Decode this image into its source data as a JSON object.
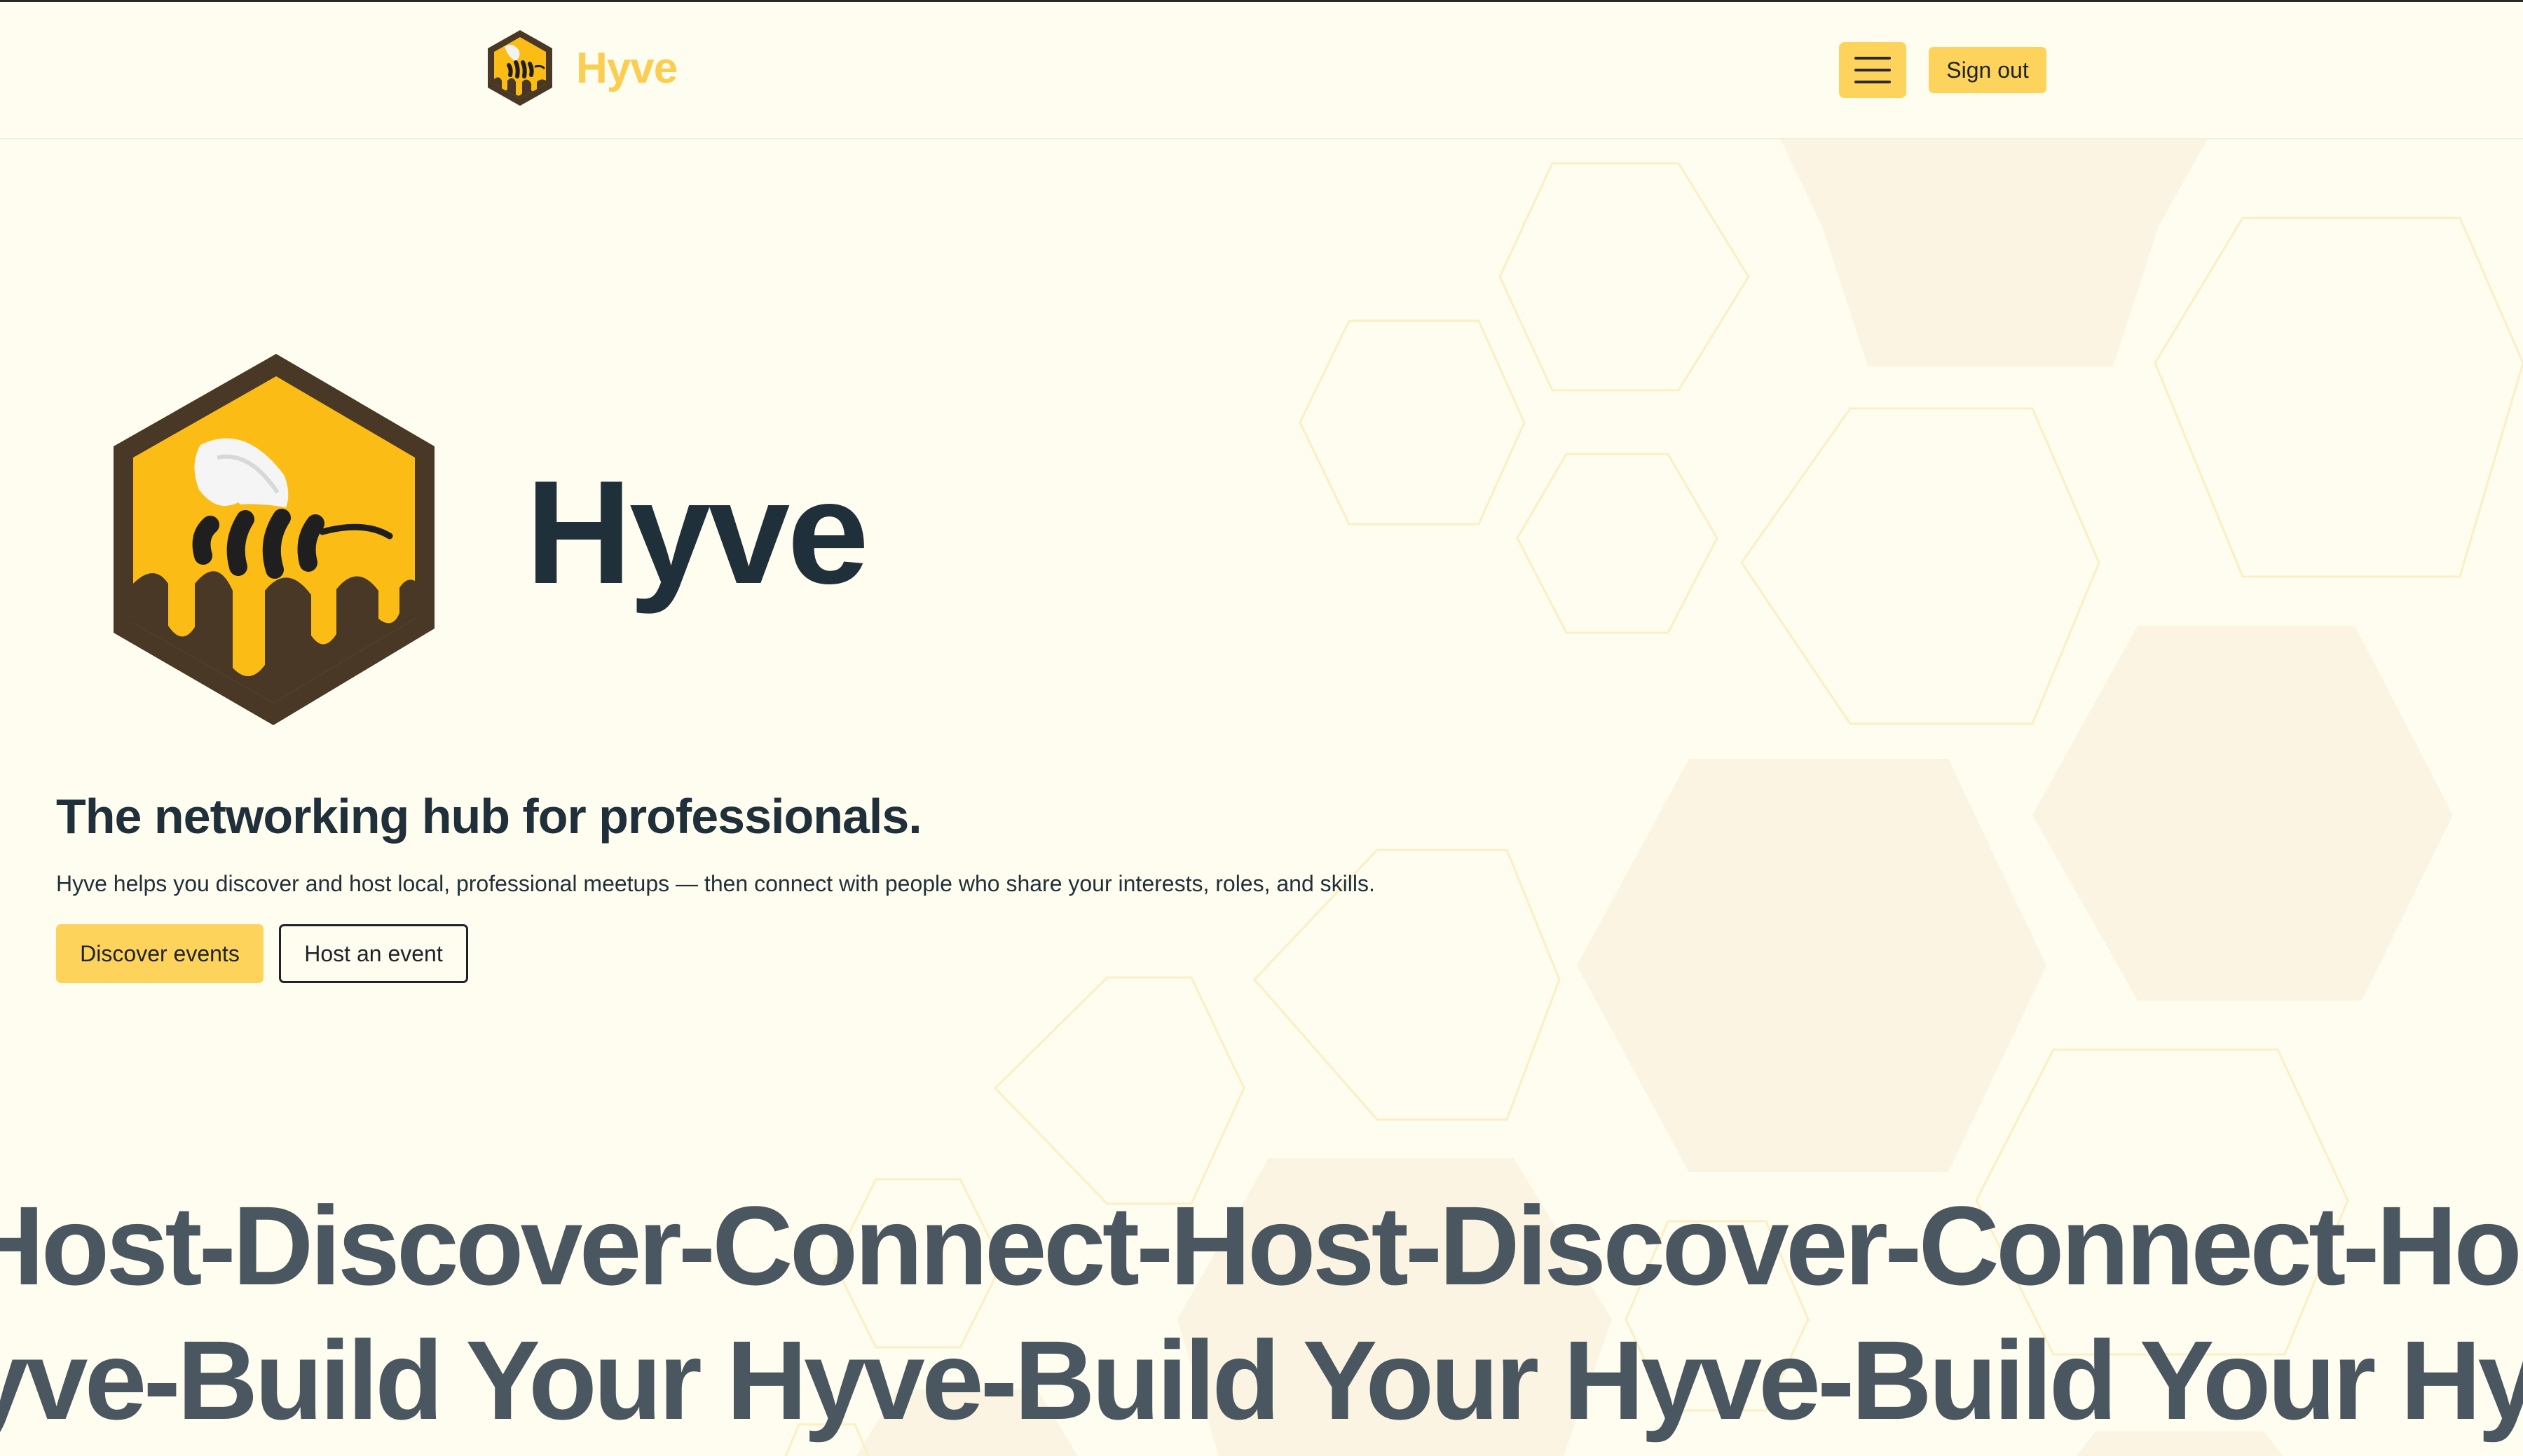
{
  "header": {
    "brand_name": "Hyve",
    "menu_icon": "hamburger-menu-icon",
    "sign_out_label": "Sign out"
  },
  "hero": {
    "title": "Hyve",
    "logo_icon": "bee-hexagon-logo-icon",
    "tagline": "The networking hub for professionals.",
    "description": "Hyve helps you discover and host local, professional meetups — then connect with people who share your interests, roles, and skills.",
    "discover_button_label": "Discover events",
    "host_button_label": "Host an event"
  },
  "marquee": {
    "row1": "Host-Discover-Connect-Host-Discover-Connect-Host-Discover-Connect",
    "row2": "Hyve-Build Your Hyve-Build Your Hyve-Build Your Hyve-Build Your"
  },
  "colors": {
    "background": "#fffdf0",
    "accent": "#fdd35c",
    "brand_text": "#fbcd51",
    "heading": "#1f303a",
    "marquee_text": "#4a5760",
    "logo_frame": "#4a3826",
    "logo_fill": "#fbbc16"
  }
}
